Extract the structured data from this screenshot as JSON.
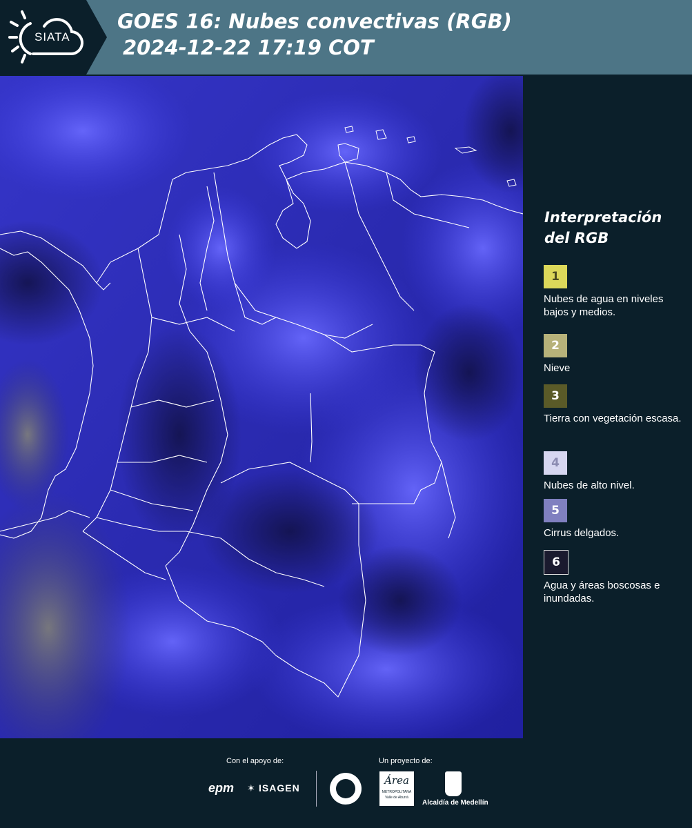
{
  "header": {
    "title_line1": "GOES 16: Nubes convectivas (RGB)",
    "title_line2": "2024-12-22 17:19 COT",
    "logo_text": "SIATA"
  },
  "legend": {
    "title_line1": "Interpretación",
    "title_line2": "del RGB",
    "items": [
      {
        "num": "1",
        "color": "#dcd85a",
        "text_color": "#4a4a20",
        "label": "Nubes de agua en niveles bajos y medios."
      },
      {
        "num": "2",
        "color": "#b7b27a",
        "text_color": "#ffffff",
        "label": "Nieve"
      },
      {
        "num": "3",
        "color": "#5a5a28",
        "text_color": "#ffffff",
        "label": "Tierra con vegetación escasa."
      },
      {
        "num": "4",
        "color": "#d6d6f0",
        "text_color": "#8a8ab0",
        "label": "Nubes de alto nivel."
      },
      {
        "num": "5",
        "color": "#8080c0",
        "text_color": "#ffffff",
        "label": "Cirrus delgados."
      },
      {
        "num": "6",
        "color": "#1a1a2e",
        "text_color": "#ffffff",
        "label": "Agua y áreas boscosas e inundadas."
      }
    ]
  },
  "footer": {
    "support_label": "Con el apoyo de:",
    "project_label": "Un proyecto de:",
    "epm": "epm",
    "isagen": "ISAGEN",
    "area_metro": "Área",
    "area_metro_sub": "METROPOLITANA",
    "area_metro_sub2": "Valle de Aburrá",
    "alcaldia": "Alcaldía de Medellín"
  },
  "colors": {
    "header_bg": "#4d7586",
    "page_bg": "#0b1f2a",
    "map_blue": "#3a3ae0",
    "boundary": "#ffffff"
  }
}
